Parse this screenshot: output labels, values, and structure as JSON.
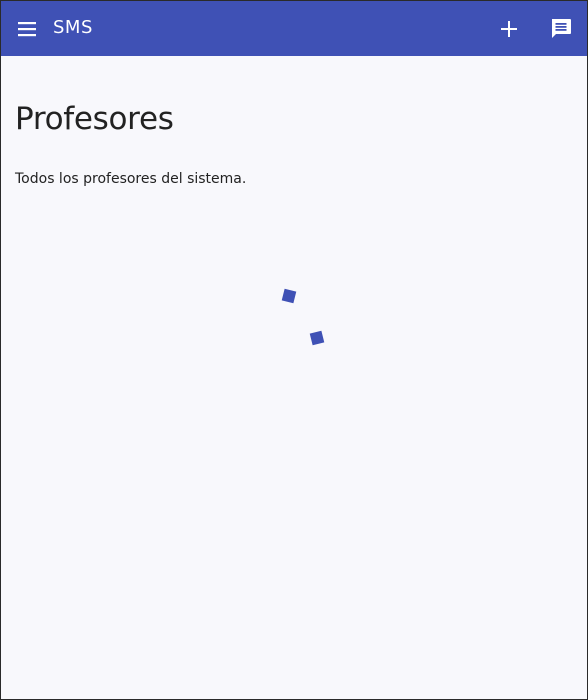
{
  "app": {
    "title": "SMS",
    "accent_color": "#3f51b5"
  },
  "toolbar": {
    "menu_icon": "menu-icon",
    "add_icon": "plus-icon",
    "chat_icon": "message-icon"
  },
  "main": {
    "title": "Profesores",
    "subtitle": "Todos los profesores del sistema."
  },
  "loading": {
    "indicator": "spinner-icon"
  }
}
